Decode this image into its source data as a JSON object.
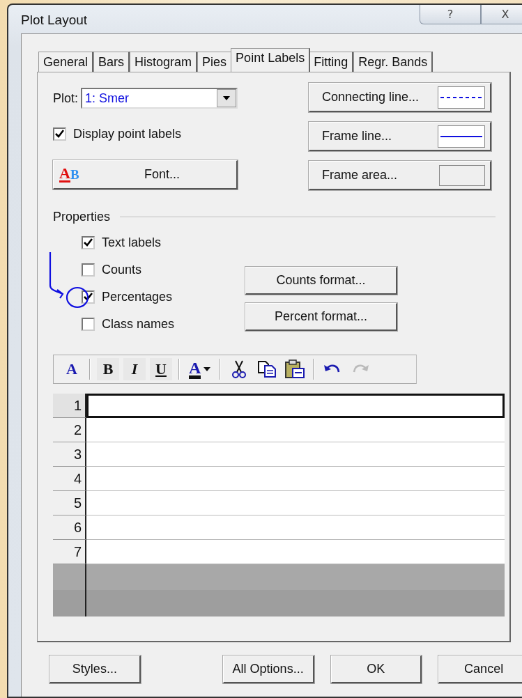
{
  "window": {
    "title": "Plot Layout",
    "title_buttons": [
      {
        "kind": "help",
        "label": "?"
      },
      {
        "kind": "close",
        "label": "X"
      }
    ]
  },
  "tabs": [
    {
      "label": "General",
      "selected": false
    },
    {
      "label": "Bars",
      "selected": false
    },
    {
      "label": "Histogram",
      "selected": false
    },
    {
      "label": "Pies",
      "selected": false
    },
    {
      "label": "Point Labels",
      "selected": true
    },
    {
      "label": "Fitting",
      "selected": false
    },
    {
      "label": "Regr. Bands",
      "selected": false
    }
  ],
  "plot": {
    "label": "Plot:",
    "value": "1: Smer"
  },
  "display_point_labels": {
    "label": "Display point labels",
    "checked": true
  },
  "font_button": {
    "icon_letters": [
      "A",
      "B"
    ],
    "label": "Font..."
  },
  "line_buttons": [
    {
      "label": "Connecting line...",
      "kind": "dashed"
    },
    {
      "label": "Frame line...",
      "kind": "solid"
    },
    {
      "label": "Frame area...",
      "kind": "area"
    }
  ],
  "properties": {
    "title": "Properties",
    "options": [
      {
        "label": "Text labels",
        "checked": true
      },
      {
        "label": "Counts",
        "checked": false
      },
      {
        "label": "Percentages",
        "checked": true
      },
      {
        "label": "Class names",
        "checked": false
      }
    ],
    "buttons": [
      "Counts format...",
      "Percent format..."
    ]
  },
  "toolbar": [
    {
      "kind": "font",
      "label": "A"
    },
    {
      "kind": "separator"
    },
    {
      "kind": "bold",
      "label": "B"
    },
    {
      "kind": "italic",
      "label": "I"
    },
    {
      "kind": "underline",
      "label": "U"
    },
    {
      "kind": "separator"
    },
    {
      "kind": "color",
      "label": "A"
    },
    {
      "kind": "separator"
    },
    {
      "kind": "cut"
    },
    {
      "kind": "copy"
    },
    {
      "kind": "paste"
    },
    {
      "kind": "separator"
    },
    {
      "kind": "undo",
      "disabled": false
    },
    {
      "kind": "redo",
      "disabled": true
    }
  ],
  "grid": {
    "rows": [
      {
        "number": "1",
        "selected": true
      },
      {
        "number": "2",
        "selected": false
      },
      {
        "number": "3",
        "selected": false
      },
      {
        "number": "4",
        "selected": false
      },
      {
        "number": "5",
        "selected": false
      },
      {
        "number": "6",
        "selected": false
      },
      {
        "number": "7",
        "selected": false
      }
    ]
  },
  "footer_buttons": [
    {
      "label": "Styles..."
    },
    {
      "label": "All Options..."
    },
    {
      "label": "OK"
    },
    {
      "label": "Cancel"
    }
  ]
}
